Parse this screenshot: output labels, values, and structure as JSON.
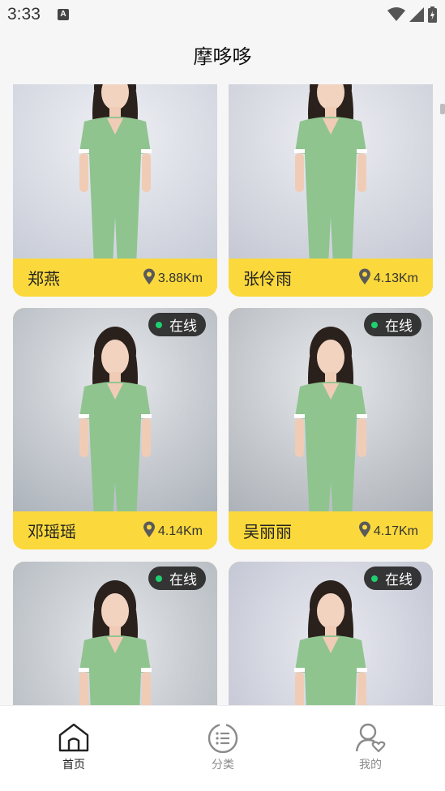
{
  "status_bar": {
    "time": "3:33",
    "notification_icon": "A"
  },
  "app": {
    "title": "摩哆哆"
  },
  "cards": [
    {
      "name": "郑燕",
      "distance": "3.88Km",
      "online": false,
      "online_label": ""
    },
    {
      "name": "张伶雨",
      "distance": "4.13Km",
      "online": false,
      "online_label": ""
    },
    {
      "name": "邓瑶瑶",
      "distance": "4.14Km",
      "online": true,
      "online_label": "在线"
    },
    {
      "name": "吴丽丽",
      "distance": "4.17Km",
      "online": true,
      "online_label": "在线"
    },
    {
      "name": "",
      "distance": "",
      "online": true,
      "online_label": "在线"
    },
    {
      "name": "",
      "distance": "",
      "online": true,
      "online_label": "在线"
    }
  ],
  "tabs": [
    {
      "label": "首页",
      "icon": "home-icon",
      "active": true
    },
    {
      "label": "分类",
      "icon": "category-icon",
      "active": false
    },
    {
      "label": "我的",
      "icon": "profile-heart-icon",
      "active": false
    }
  ],
  "colors": {
    "accent_yellow": "#fbd93c",
    "online_green": "#1fd06f",
    "scrub_green": "#8fc48f",
    "tab_active": "#222222",
    "tab_inactive": "#8a8a8a"
  }
}
